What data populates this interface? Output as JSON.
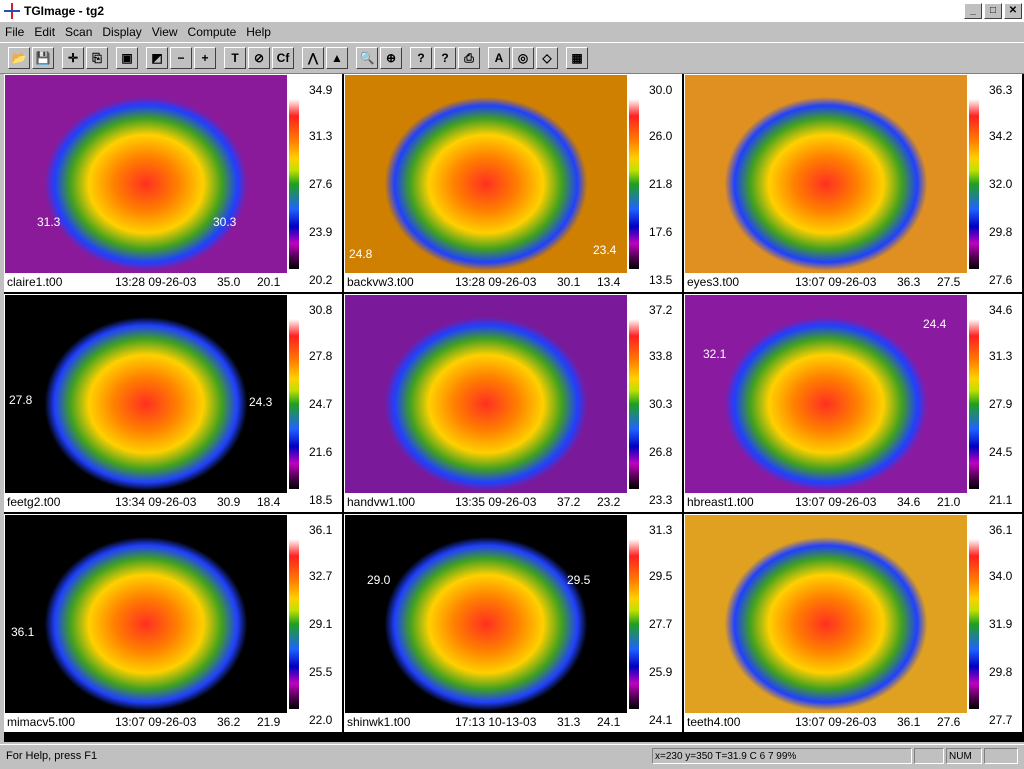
{
  "window": {
    "title": "TGImage - tg2"
  },
  "window_buttons": [
    "_",
    "□",
    "✕"
  ],
  "menu": [
    "File",
    "Edit",
    "Scan",
    "Display",
    "View",
    "Compute",
    "Help"
  ],
  "toolbar": [
    {
      "icon": "open-folder-icon",
      "glyph": "📂"
    },
    {
      "icon": "save-icon",
      "glyph": "💾"
    },
    {
      "icon": "crosshair-icon",
      "glyph": "✛"
    },
    {
      "icon": "copy-icon",
      "glyph": "⎘"
    },
    {
      "icon": "camera-icon",
      "glyph": "▣"
    },
    {
      "icon": "diagonal-palette-icon",
      "glyph": "◩"
    },
    {
      "icon": "minus-icon",
      "glyph": "−"
    },
    {
      "icon": "plus-icon",
      "glyph": "+"
    },
    {
      "icon": "text-t-icon",
      "glyph": "T"
    },
    {
      "icon": "no-symbol-icon",
      "glyph": "⊘"
    },
    {
      "icon": "cf-icon",
      "glyph": "Cf"
    },
    {
      "icon": "histogram-icon",
      "glyph": "⋀"
    },
    {
      "icon": "stamp-icon",
      "glyph": "▲"
    },
    {
      "icon": "magnifier-icon",
      "glyph": "🔍"
    },
    {
      "icon": "zoom-reset-icon",
      "glyph": "⊕"
    },
    {
      "icon": "context-help-icon",
      "glyph": "?"
    },
    {
      "icon": "help-icon",
      "glyph": "?"
    },
    {
      "icon": "print-icon",
      "glyph": "⎙"
    },
    {
      "icon": "text-a-icon",
      "glyph": "A"
    },
    {
      "icon": "target-icon",
      "glyph": "◎"
    },
    {
      "icon": "eraser-icon",
      "glyph": "◇"
    },
    {
      "icon": "color-palette-icon",
      "glyph": "▦"
    }
  ],
  "panels": [
    {
      "file": "claire1.t00",
      "time": "13:28 09-26-03",
      "max": "35.0",
      "min": "20.1",
      "scale": [
        "34.9",
        "31.3",
        "27.6",
        "23.9",
        "20.2"
      ],
      "annotations": [
        "31.3",
        "30.3"
      ],
      "bg": "#8a1a9a"
    },
    {
      "file": "backvw3.t00",
      "time": "13:28 09-26-03",
      "max": "30.1",
      "min": "13.4",
      "scale": [
        "30.0",
        "26.0",
        "21.8",
        "17.6",
        "13.5"
      ],
      "annotations": [
        "24.8",
        "23.4"
      ],
      "bg": "#d08000"
    },
    {
      "file": "eyes3.t00",
      "time": "13:07 09-26-03",
      "max": "36.3",
      "min": "27.5",
      "scale": [
        "36.3",
        "34.2",
        "32.0",
        "29.8",
        "27.6"
      ],
      "annotations": [],
      "bg": "#e09020"
    },
    {
      "file": "feetg2.t00",
      "time": "13:34 09-26-03",
      "max": "30.9",
      "min": "18.4",
      "scale": [
        "30.8",
        "27.8",
        "24.7",
        "21.6",
        "18.5"
      ],
      "annotations": [
        "27.8",
        "24.3"
      ],
      "bg": "#000000"
    },
    {
      "file": "handvw1.t00",
      "time": "13:35 09-26-03",
      "max": "37.2",
      "min": "23.2",
      "scale": [
        "37.2",
        "33.8",
        "30.3",
        "26.8",
        "23.3"
      ],
      "annotations": [],
      "bg": "#7a1a9a"
    },
    {
      "file": "hbreast1.t00",
      "time": "13:07 09-26-03",
      "max": "34.6",
      "min": "21.0",
      "scale": [
        "34.6",
        "31.3",
        "27.9",
        "24.5",
        "21.1"
      ],
      "annotations": [
        "32.1",
        "24.4"
      ],
      "bg": "#8a1aa0"
    },
    {
      "file": "mimacv5.t00",
      "time": "13:07 09-26-03",
      "max": "36.2",
      "min": "21.9",
      "scale": [
        "36.1",
        "32.7",
        "29.1",
        "25.5",
        "22.0"
      ],
      "annotations": [
        "36.1"
      ],
      "bg": "#000000"
    },
    {
      "file": "shinwk1.t00",
      "time": "17:13 10-13-03",
      "max": "31.3",
      "min": "24.1",
      "scale": [
        "31.3",
        "29.5",
        "27.7",
        "25.9",
        "24.1"
      ],
      "annotations": [
        "29.0",
        "29.5"
      ],
      "bg": "#000000"
    },
    {
      "file": "teeth4.t00",
      "time": "13:07 09-26-03",
      "max": "36.1",
      "min": "27.6",
      "scale": [
        "36.1",
        "34.0",
        "31.9",
        "29.8",
        "27.7"
      ],
      "annotations": [],
      "bg": "#e0a020"
    }
  ],
  "status": {
    "help": "For Help, press F1",
    "coords": "x=230 y=350  T=31.9 C 6 7 99%",
    "num": "NUM"
  }
}
